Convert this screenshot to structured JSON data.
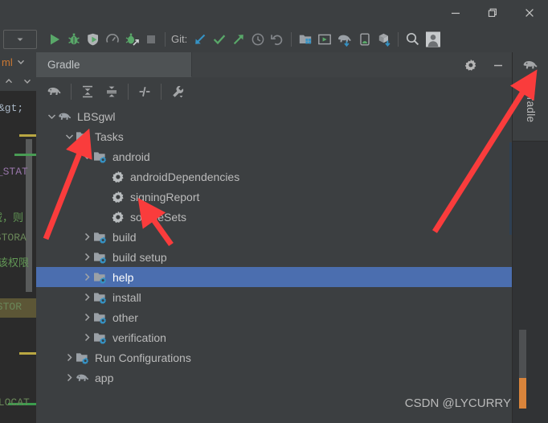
{
  "window": {
    "controls": [
      {
        "name": "minimize",
        "glyph": "minimize-icon"
      },
      {
        "name": "restore",
        "glyph": "restore-icon"
      },
      {
        "name": "close",
        "glyph": "close-icon"
      }
    ]
  },
  "toolbar": {
    "module_selector_label": "",
    "git_label": "Git:",
    "buttons": [
      {
        "name": "run-button",
        "icon": "run-icon",
        "tooltip": "Run"
      },
      {
        "name": "debug-button",
        "icon": "debug-bug-icon",
        "tooltip": "Debug"
      },
      {
        "name": "run-with-coverage-button",
        "icon": "shield-run-icon",
        "tooltip": "Run with Coverage"
      },
      {
        "name": "profiler-button",
        "icon": "gauge-icon",
        "tooltip": "Profile"
      },
      {
        "name": "attach-debugger-button",
        "icon": "bug-attach-icon",
        "tooltip": "Attach debugger to process"
      },
      {
        "name": "stop-button",
        "icon": "stop-square-icon",
        "tooltip": "Stop"
      },
      {
        "name": "git-update-button",
        "icon": "arrow-down-left-icon",
        "tooltip": "Update Project"
      },
      {
        "name": "git-commit-button",
        "icon": "checkmark-icon",
        "tooltip": "Commit"
      },
      {
        "name": "git-push-button",
        "icon": "arrow-up-right-icon",
        "tooltip": "Push"
      },
      {
        "name": "git-history-button",
        "icon": "clock-icon",
        "tooltip": "Show History"
      },
      {
        "name": "git-revert-button",
        "icon": "undo-icon",
        "tooltip": "Rollback"
      },
      {
        "name": "sdk-manager-button",
        "icon": "folder-blocks-icon",
        "tooltip": "SDK Manager"
      },
      {
        "name": "avd-manager-button",
        "icon": "device-screen-icon",
        "tooltip": "AVD Manager"
      },
      {
        "name": "sync-gradle-button",
        "icon": "elephant-sync-icon",
        "tooltip": "Sync Project with Gradle Files"
      },
      {
        "name": "device-file-explorer-button",
        "icon": "android-device-icon",
        "tooltip": "Device File Explorer"
      },
      {
        "name": "layout-inspector-button",
        "icon": "cube-download-icon",
        "tooltip": "Layout Inspector"
      },
      {
        "name": "search-everywhere-button",
        "icon": "search-icon",
        "tooltip": "Search Everywhere"
      },
      {
        "name": "account-button",
        "icon": "user-avatar-icon",
        "tooltip": "Account"
      }
    ]
  },
  "editor_edge": {
    "tab_label": "ml",
    "code_fragments": [
      "&gt;",
      "X_STAT",
      "域，则",
      "_STORA",
      "请该权限",
      "_STOR",
      "_LOCAT"
    ]
  },
  "gradle_panel": {
    "tab_title": "Gradle",
    "header_buttons": [
      {
        "name": "settings-button",
        "icon": "gear-icon"
      },
      {
        "name": "hide-button",
        "icon": "minimize-icon"
      }
    ],
    "toolbar_buttons": [
      {
        "name": "reload-gradle-project-button",
        "icon": "elephant-icon"
      },
      {
        "name": "expand-all-button",
        "icon": "expand-all-icon"
      },
      {
        "name": "collapse-all-button",
        "icon": "collapse-all-icon"
      },
      {
        "name": "toggle-offline-mode-button",
        "icon": "offline-mode-icon"
      },
      {
        "name": "gradle-settings-button",
        "icon": "wrench-icon"
      }
    ],
    "tree": [
      {
        "label": "LBSgwl",
        "depth": 0,
        "arrow": "down",
        "icon": "elephant-icon",
        "selected": false
      },
      {
        "label": "Tasks",
        "depth": 1,
        "arrow": "down",
        "icon": "folder-gear-icon",
        "selected": false
      },
      {
        "label": "android",
        "depth": 2,
        "arrow": "down",
        "icon": "folder-gear-icon",
        "selected": false
      },
      {
        "label": "androidDependencies",
        "depth": 3,
        "arrow": "none",
        "icon": "gear-icon",
        "selected": false
      },
      {
        "label": "signingReport",
        "depth": 3,
        "arrow": "none",
        "icon": "gear-icon",
        "selected": false
      },
      {
        "label": "sourceSets",
        "depth": 3,
        "arrow": "none",
        "icon": "gear-icon",
        "selected": false
      },
      {
        "label": "build",
        "depth": 2,
        "arrow": "right",
        "icon": "folder-gear-icon",
        "selected": false
      },
      {
        "label": "build setup",
        "depth": 2,
        "arrow": "right",
        "icon": "folder-gear-icon",
        "selected": false
      },
      {
        "label": "help",
        "depth": 2,
        "arrow": "right",
        "icon": "folder-gear-icon",
        "selected": true
      },
      {
        "label": "install",
        "depth": 2,
        "arrow": "right",
        "icon": "folder-gear-icon",
        "selected": false
      },
      {
        "label": "other",
        "depth": 2,
        "arrow": "right",
        "icon": "folder-gear-icon",
        "selected": false
      },
      {
        "label": "verification",
        "depth": 2,
        "arrow": "right",
        "icon": "folder-gear-icon",
        "selected": false
      },
      {
        "label": "Run Configurations",
        "depth": 1,
        "arrow": "right",
        "icon": "folder-gear-icon",
        "selected": false
      },
      {
        "label": "app",
        "depth": 1,
        "arrow": "right",
        "icon": "elephant-icon",
        "selected": false
      }
    ]
  },
  "right_strip": {
    "tool_label": "Gradle",
    "icon": "elephant-icon"
  },
  "watermark": {
    "text": "CSDN @LYCURRY"
  },
  "colors": {
    "background": "#3c3f41",
    "editor_background": "#2b2b2b",
    "selection": "#4b6eaf",
    "accent_blue": "#3592c4",
    "annotation_red": "#fa3c3c",
    "text": "#bbbbbb",
    "tab_active": "#4e5254",
    "folder_gray": "#9aa0a6",
    "green_run": "#59a869",
    "orange_text": "#cc7832",
    "comment_green": "#629755"
  }
}
